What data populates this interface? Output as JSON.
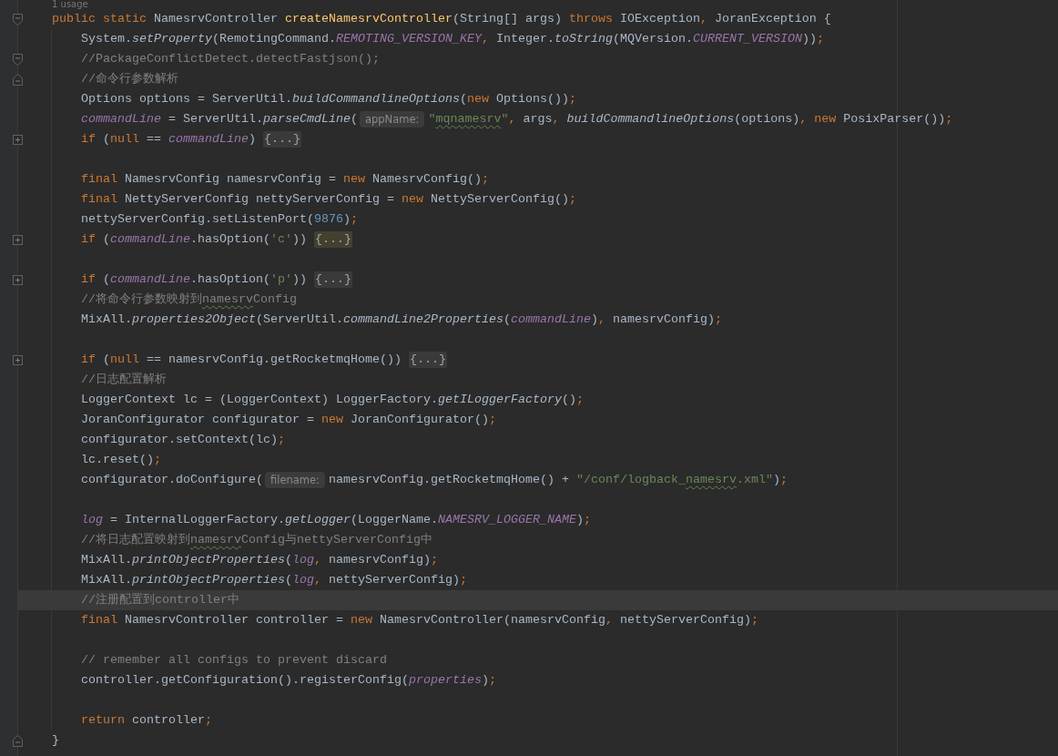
{
  "usage_hint": "1 usage",
  "code_lines": [
    {
      "selected": false,
      "kind": "foldstart",
      "tokens": [
        {
          "kind": "kw",
          "text": "public static "
        },
        {
          "kind": "plain",
          "text": "NamesrvController "
        },
        {
          "kind": "decl",
          "text": "createNamesrvController"
        },
        {
          "kind": "plain",
          "text": "(String[] args) "
        },
        {
          "kind": "kw",
          "text": "throws "
        },
        {
          "kind": "plain",
          "text": "IOException"
        },
        {
          "kind": "punct",
          "text": ", "
        },
        {
          "kind": "plain",
          "text": "JoranException {"
        }
      ],
      "children": [
        {
          "selected": false,
          "kind": "line",
          "tokens": [
            {
              "kind": "plain",
              "text": "System."
            },
            {
              "kind": "italic",
              "text": "setProperty"
            },
            {
              "kind": "plain",
              "text": "(RemotingCommand."
            },
            {
              "kind": "sfield",
              "text": "REMOTING_VERSION_KEY"
            },
            {
              "kind": "punct",
              "text": ", "
            },
            {
              "kind": "plain",
              "text": "Integer."
            },
            {
              "kind": "italic",
              "text": "toString"
            },
            {
              "kind": "plain",
              "text": "(MQVersion."
            },
            {
              "kind": "sfield",
              "text": "CURRENT_VERSION"
            },
            {
              "kind": "plain",
              "text": "))"
            },
            {
              "kind": "punct",
              "text": ";"
            }
          ]
        },
        {
          "selected": false,
          "kind": "foldstart",
          "tokens": [
            {
              "kind": "comment",
              "text": "//PackageConflictDetect.detectFastjson();"
            }
          ]
        },
        {
          "selected": false,
          "kind": "foldend",
          "tokens": [
            {
              "kind": "comment",
              "text": "//命令行参数解析"
            }
          ]
        },
        {
          "selected": false,
          "kind": "line",
          "tokens": [
            {
              "kind": "plain",
              "text": "Options options = ServerUtil."
            },
            {
              "kind": "italic",
              "text": "buildCommandlineOptions"
            },
            {
              "kind": "plain",
              "text": "("
            },
            {
              "kind": "kw",
              "text": "new "
            },
            {
              "kind": "plain",
              "text": "Options())"
            },
            {
              "kind": "punct",
              "text": ";"
            }
          ]
        },
        {
          "selected": false,
          "kind": "line",
          "tokens": [
            {
              "kind": "sfield",
              "text": "commandLine"
            },
            {
              "kind": "plain",
              "text": " = ServerUtil."
            },
            {
              "kind": "italic",
              "text": "parseCmdLine"
            },
            {
              "kind": "plain",
              "text": "("
            },
            {
              "kind": "hint",
              "text": "appName:"
            },
            {
              "kind": "string",
              "text": "\""
            },
            {
              "kind": "misspelled",
              "text": "mqnamesrv"
            },
            {
              "kind": "string",
              "text": "\""
            },
            {
              "kind": "punct",
              "text": ", "
            },
            {
              "kind": "plain",
              "text": "args"
            },
            {
              "kind": "punct",
              "text": ", "
            },
            {
              "kind": "italic",
              "text": "buildCommandlineOptions"
            },
            {
              "kind": "plain",
              "text": "(options)"
            },
            {
              "kind": "punct",
              "text": ", "
            },
            {
              "kind": "kw",
              "text": "new "
            },
            {
              "kind": "plain",
              "text": "PosixParser())"
            },
            {
              "kind": "punct",
              "text": ";"
            }
          ]
        },
        {
          "selected": false,
          "kind": "folded",
          "tokens": [
            {
              "kind": "kw",
              "text": "if "
            },
            {
              "kind": "plain",
              "text": "("
            },
            {
              "kind": "kw",
              "text": "null "
            },
            {
              "kind": "plain",
              "text": "== "
            },
            {
              "kind": "sfield",
              "text": "commandLine"
            },
            {
              "kind": "plain",
              "text": ") "
            },
            {
              "kind": "fold",
              "text": "{...}"
            }
          ]
        },
        {
          "selected": false,
          "kind": "line"
        },
        {
          "selected": false,
          "kind": "line",
          "tokens": [
            {
              "kind": "kw",
              "text": "final "
            },
            {
              "kind": "plain",
              "text": "NamesrvConfig namesrvConfig = "
            },
            {
              "kind": "kw",
              "text": "new "
            },
            {
              "kind": "plain",
              "text": "NamesrvConfig()"
            },
            {
              "kind": "punct",
              "text": ";"
            }
          ]
        },
        {
          "selected": false,
          "kind": "line",
          "tokens": [
            {
              "kind": "kw",
              "text": "final "
            },
            {
              "kind": "plain",
              "text": "NettyServerConfig nettyServerConfig = "
            },
            {
              "kind": "kw",
              "text": "new "
            },
            {
              "kind": "plain",
              "text": "NettyServerConfig()"
            },
            {
              "kind": "punct",
              "text": ";"
            }
          ]
        },
        {
          "selected": false,
          "kind": "line",
          "tokens": [
            {
              "kind": "plain",
              "text": "nettyServerConfig.setListenPort("
            },
            {
              "kind": "number",
              "text": "9876"
            },
            {
              "kind": "plain",
              "text": ")"
            },
            {
              "kind": "punct",
              "text": ";"
            }
          ]
        },
        {
          "selected": false,
          "kind": "folded",
          "tokens": [
            {
              "kind": "kw",
              "text": "if "
            },
            {
              "kind": "plain",
              "text": "("
            },
            {
              "kind": "sfield",
              "text": "commandLine"
            },
            {
              "kind": "plain",
              "text": ".hasOption("
            },
            {
              "kind": "string",
              "text": "'c'"
            },
            {
              "kind": "plain",
              "text": ")) "
            },
            {
              "kind": "foldhighlight",
              "text": "{...}"
            }
          ]
        },
        {
          "selected": false,
          "kind": "line"
        },
        {
          "selected": false,
          "kind": "folded",
          "tokens": [
            {
              "kind": "kw",
              "text": "if "
            },
            {
              "kind": "plain",
              "text": "("
            },
            {
              "kind": "sfield",
              "text": "commandLine"
            },
            {
              "kind": "plain",
              "text": ".hasOption("
            },
            {
              "kind": "string",
              "text": "'p'"
            },
            {
              "kind": "plain",
              "text": ")) "
            },
            {
              "kind": "fold",
              "text": "{...}"
            }
          ]
        },
        {
          "selected": false,
          "kind": "line",
          "tokens": [
            {
              "kind": "comment",
              "text": "//将命令行参数映射到"
            },
            {
              "kind": "misspelled",
              "text": "namesrv"
            },
            {
              "kind": "comment",
              "text": "Config"
            }
          ]
        },
        {
          "selected": false,
          "kind": "line",
          "tokens": [
            {
              "kind": "plain",
              "text": "MixAll."
            },
            {
              "kind": "italic",
              "text": "properties2Object"
            },
            {
              "kind": "plain",
              "text": "(ServerUtil."
            },
            {
              "kind": "italic",
              "text": "commandLine2Properties"
            },
            {
              "kind": "plain",
              "text": "("
            },
            {
              "kind": "sfield",
              "text": "commandLine"
            },
            {
              "kind": "plain",
              "text": ")"
            },
            {
              "kind": "punct",
              "text": ", "
            },
            {
              "kind": "plain",
              "text": "namesrvConfig)"
            },
            {
              "kind": "punct",
              "text": ";"
            }
          ]
        },
        {
          "selected": false,
          "kind": "line"
        },
        {
          "selected": false,
          "kind": "folded",
          "tokens": [
            {
              "kind": "kw",
              "text": "if "
            },
            {
              "kind": "plain",
              "text": "("
            },
            {
              "kind": "kw",
              "text": "null "
            },
            {
              "kind": "plain",
              "text": "== namesrvConfig.getRocketmqHome()) "
            },
            {
              "kind": "fold",
              "text": "{...}"
            }
          ]
        },
        {
          "selected": false,
          "kind": "line",
          "tokens": [
            {
              "kind": "comment",
              "text": "//日志配置解析"
            }
          ]
        },
        {
          "selected": false,
          "kind": "line",
          "tokens": [
            {
              "kind": "plain",
              "text": "LoggerContext lc = (LoggerContext) LoggerFactory."
            },
            {
              "kind": "italic",
              "text": "getILoggerFactory"
            },
            {
              "kind": "plain",
              "text": "()"
            },
            {
              "kind": "punct",
              "text": ";"
            }
          ]
        },
        {
          "selected": false,
          "kind": "line",
          "tokens": [
            {
              "kind": "plain",
              "text": "JoranConfigurator configurator = "
            },
            {
              "kind": "kw",
              "text": "new "
            },
            {
              "kind": "plain",
              "text": "JoranConfigurator()"
            },
            {
              "kind": "punct",
              "text": ";"
            }
          ]
        },
        {
          "selected": false,
          "kind": "line",
          "tokens": [
            {
              "kind": "plain",
              "text": "configurator.setContext(lc)"
            },
            {
              "kind": "punct",
              "text": ";"
            }
          ]
        },
        {
          "selected": false,
          "kind": "line",
          "tokens": [
            {
              "kind": "plain",
              "text": "lc.reset()"
            },
            {
              "kind": "punct",
              "text": ";"
            }
          ]
        },
        {
          "selected": false,
          "kind": "line",
          "tokens": [
            {
              "kind": "plain",
              "text": "configurator.doConfigure("
            },
            {
              "kind": "hint",
              "text": "filename:"
            },
            {
              "kind": "plain",
              "text": "namesrvConfig.getRocketmqHome() + "
            },
            {
              "kind": "string",
              "text": "\"/conf/logback_"
            },
            {
              "kind": "misspelled",
              "text": "namesrv"
            },
            {
              "kind": "string",
              "text": ".xml\""
            },
            {
              "kind": "plain",
              "text": ")"
            },
            {
              "kind": "punct",
              "text": ";"
            }
          ]
        },
        {
          "selected": false,
          "kind": "line"
        },
        {
          "selected": false,
          "kind": "line",
          "tokens": [
            {
              "kind": "sfield",
              "text": "log"
            },
            {
              "kind": "plain",
              "text": " = InternalLoggerFactory."
            },
            {
              "kind": "italic",
              "text": "getLogger"
            },
            {
              "kind": "plain",
              "text": "(LoggerName."
            },
            {
              "kind": "sfield",
              "text": "NAMESRV_LOGGER_NAME"
            },
            {
              "kind": "plain",
              "text": ")"
            },
            {
              "kind": "punct",
              "text": ";"
            }
          ]
        },
        {
          "selected": false,
          "kind": "line",
          "tokens": [
            {
              "kind": "comment",
              "text": "//将日志配置映射到"
            },
            {
              "kind": "misspelled",
              "text": "namesrv"
            },
            {
              "kind": "comment",
              "text": "Config与nettyServerConfig中"
            }
          ]
        },
        {
          "selected": false,
          "kind": "line",
          "tokens": [
            {
              "kind": "plain",
              "text": "MixAll."
            },
            {
              "kind": "italic",
              "text": "printObjectProperties"
            },
            {
              "kind": "plain",
              "text": "("
            },
            {
              "kind": "sfield",
              "text": "log"
            },
            {
              "kind": "punct",
              "text": ", "
            },
            {
              "kind": "plain",
              "text": "namesrvConfig)"
            },
            {
              "kind": "punct",
              "text": ";"
            }
          ]
        },
        {
          "selected": false,
          "kind": "line",
          "tokens": [
            {
              "kind": "plain",
              "text": "MixAll."
            },
            {
              "kind": "italic",
              "text": "printObjectProperties"
            },
            {
              "kind": "plain",
              "text": "("
            },
            {
              "kind": "sfield",
              "text": "log"
            },
            {
              "kind": "punct",
              "text": ", "
            },
            {
              "kind": "plain",
              "text": "nettyServerConfig)"
            },
            {
              "kind": "punct",
              "text": ";"
            }
          ]
        },
        {
          "selected": true,
          "kind": "line",
          "tokens": [
            {
              "kind": "comment",
              "text": "//注册配置到controller中"
            }
          ]
        },
        {
          "selected": false,
          "kind": "line",
          "tokens": [
            {
              "kind": "kw",
              "text": "final "
            },
            {
              "kind": "plain",
              "text": "NamesrvController controller = "
            },
            {
              "kind": "kw",
              "text": "new "
            },
            {
              "kind": "plain",
              "text": "NamesrvController(namesrvConfig"
            },
            {
              "kind": "punct",
              "text": ", "
            },
            {
              "kind": "plain",
              "text": "nettyServerConfig)"
            },
            {
              "kind": "punct",
              "text": ";"
            }
          ]
        },
        {
          "selected": false,
          "kind": "line"
        },
        {
          "selected": false,
          "kind": "line",
          "tokens": [
            {
              "kind": "comment",
              "text": "// remember all configs to prevent discard"
            }
          ]
        },
        {
          "selected": false,
          "kind": "line",
          "tokens": [
            {
              "kind": "plain",
              "text": "controller.getConfiguration().registerConfig("
            },
            {
              "kind": "sfield",
              "text": "properties"
            },
            {
              "kind": "plain",
              "text": ")"
            },
            {
              "kind": "punct",
              "text": ";"
            }
          ]
        },
        {
          "selected": false,
          "kind": "line"
        },
        {
          "selected": false,
          "kind": "line",
          "tokens": [
            {
              "kind": "kw",
              "text": "return "
            },
            {
              "kind": "plain",
              "text": "controller"
            },
            {
              "kind": "punct",
              "text": ";"
            }
          ]
        }
      ]
    },
    {
      "selected": false,
      "kind": "foldend",
      "tokens": [
        {
          "kind": "plain",
          "text": "}"
        }
      ]
    }
  ]
}
